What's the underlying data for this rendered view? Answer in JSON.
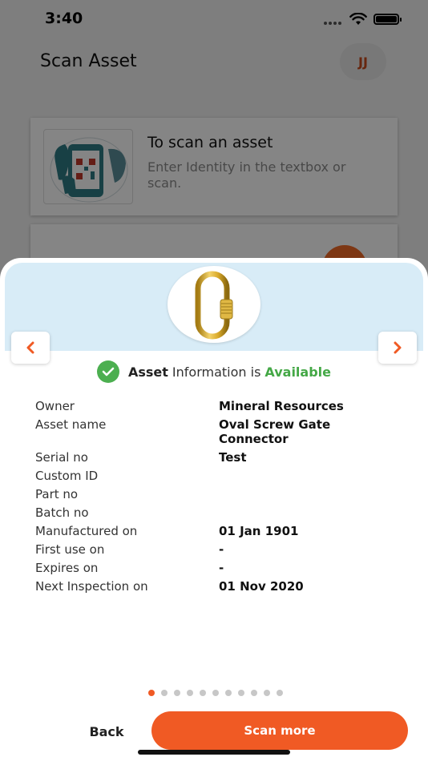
{
  "status_bar": {
    "time": "3:40"
  },
  "header": {
    "title": "Scan Asset",
    "avatar_initials": "JJ"
  },
  "scan_card": {
    "title": "To scan an asset",
    "description": "Enter Identity in the textbox or scan."
  },
  "sheet": {
    "availability": {
      "part1": "Asset",
      "part2": "Information is",
      "part3": "Available"
    },
    "rows": [
      {
        "label": "Owner",
        "value": "Mineral Resources"
      },
      {
        "label": "Asset name",
        "value": "Oval Screw Gate Connector"
      },
      {
        "label": "Serial no",
        "value": "Test"
      },
      {
        "label": "Custom ID",
        "value": ""
      },
      {
        "label": "Part no",
        "value": ""
      },
      {
        "label": "Batch no",
        "value": ""
      },
      {
        "label": "Manufactured on",
        "value": "01 Jan 1901"
      },
      {
        "label": "First use on",
        "value": "-"
      },
      {
        "label": "Expires on",
        "value": "-"
      },
      {
        "label": "Next Inspection on",
        "value": "01 Nov 2020"
      }
    ],
    "pager": {
      "total": 11,
      "active_index": 0
    },
    "back_label": "Back",
    "scan_more_label": "Scan more"
  },
  "colors": {
    "accent": "#f05a24",
    "available_green": "#44a846",
    "header_blue": "#d8ecf7"
  }
}
